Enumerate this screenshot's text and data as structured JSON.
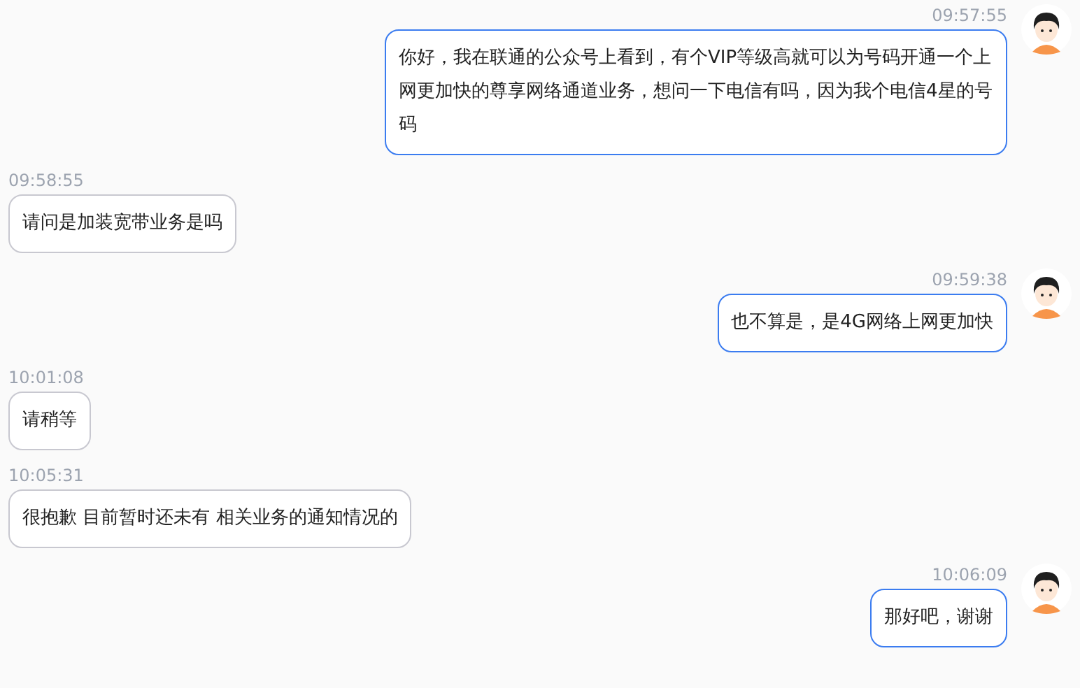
{
  "messages": [
    {
      "kind": "user",
      "time": "09:57:55",
      "text": "你好，我在联通的公众号上看到，有个VIP等级高就可以为号码开通一个上网更加快的尊享网络通道业务，想问一下电信有吗，因为我个电信4星的号码"
    },
    {
      "kind": "agent",
      "time": "09:58:55",
      "text": "请问是加装宽带业务是吗"
    },
    {
      "kind": "user",
      "time": "09:59:38",
      "text": "也不算是，是4G网络上网更加快"
    },
    {
      "kind": "agent",
      "time": "10:01:08",
      "text": "请稍等"
    },
    {
      "kind": "agent",
      "time": "10:05:31",
      "text": "很抱歉 目前暂时还未有 相关业务的通知情况的"
    },
    {
      "kind": "user",
      "time": "10:06:09",
      "text": "那好吧，谢谢"
    }
  ]
}
